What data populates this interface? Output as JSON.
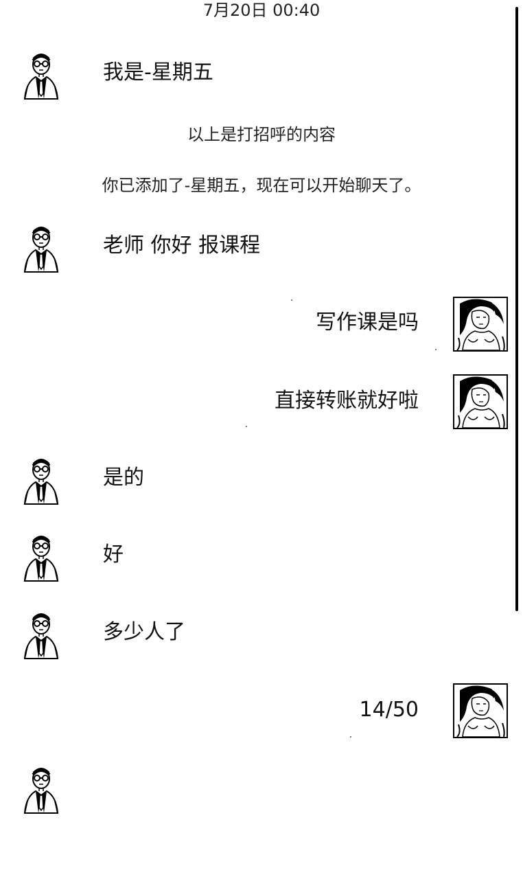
{
  "chat": {
    "timestamp": "7月20日 00:40",
    "system_notices": [
      "以上是打招呼的内容",
      "你已添加了-星期五，现在可以开始聊天了。"
    ],
    "messages": [
      {
        "side": "left",
        "text": "我是-星期五",
        "avatar_icon": "man-with-glasses-avatar-icon"
      },
      {
        "side": "left",
        "text": "老师 你好 报课程",
        "avatar_icon": "man-with-glasses-avatar-icon"
      },
      {
        "side": "right",
        "text": "写作课是吗",
        "avatar_icon": "woman-sketch-avatar-icon"
      },
      {
        "side": "right",
        "text": "直接转账就好啦",
        "avatar_icon": "woman-sketch-avatar-icon"
      },
      {
        "side": "left",
        "text": "是的",
        "avatar_icon": "man-with-glasses-avatar-icon"
      },
      {
        "side": "left",
        "text": "好",
        "avatar_icon": "man-with-glasses-avatar-icon"
      },
      {
        "side": "left",
        "text": "多少人了",
        "avatar_icon": "man-with-glasses-avatar-icon"
      },
      {
        "side": "right",
        "text": "14/50",
        "avatar_icon": "woman-sketch-avatar-icon"
      },
      {
        "side": "left",
        "text": "",
        "avatar_icon": "man-with-glasses-avatar-icon"
      }
    ]
  }
}
